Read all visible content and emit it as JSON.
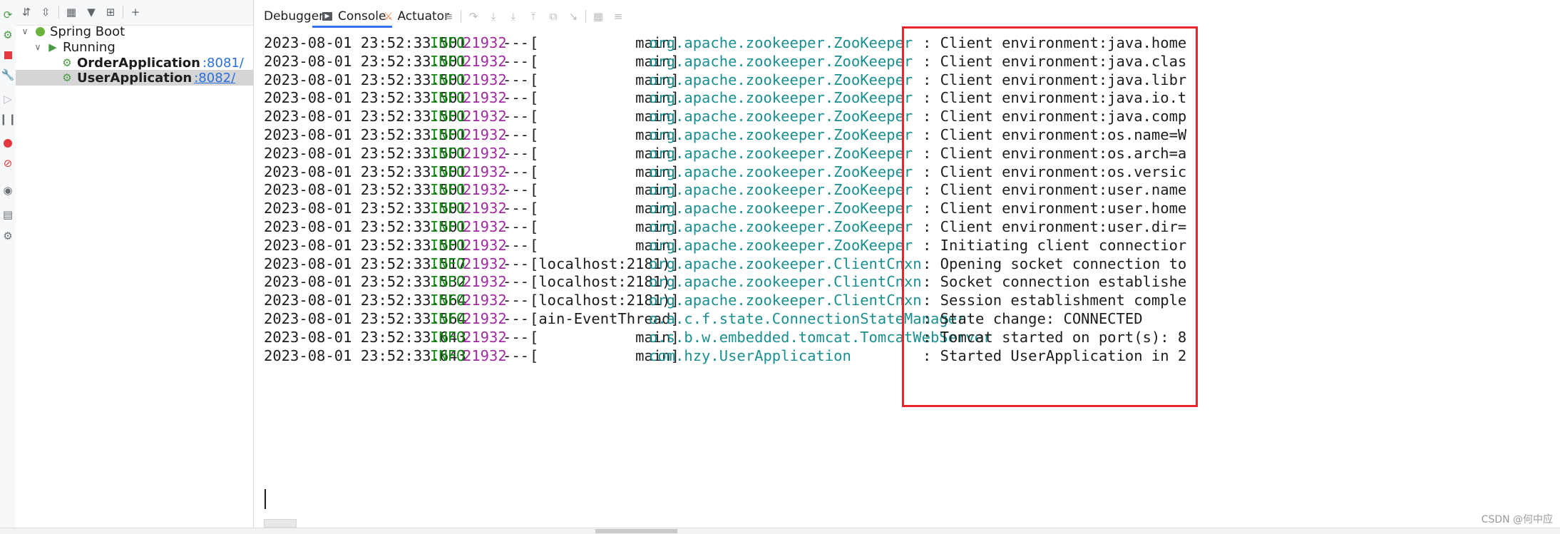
{
  "tree": {
    "root": "Spring Boot",
    "group": "Running",
    "apps": [
      {
        "name": "OrderApplication",
        "port": ":8081/"
      },
      {
        "name": "UserApplication",
        "port": ":8082/"
      }
    ]
  },
  "tabs": {
    "debugger": "Debugger",
    "console": "Console",
    "actuator": "Actuator"
  },
  "log": [
    {
      "ts": "2023-08-01 23:52:33.501",
      "level": "INFO",
      "pid": "21932",
      "sep": "---",
      "thread": "[           main]",
      "logger": "org.apache.zookeeper.ZooKeeper",
      "msg": ": Client environment:java.home"
    },
    {
      "ts": "2023-08-01 23:52:33.501",
      "level": "INFO",
      "pid": "21932",
      "sep": "---",
      "thread": "[           main]",
      "logger": "org.apache.zookeeper.ZooKeeper",
      "msg": ": Client environment:java.clas"
    },
    {
      "ts": "2023-08-01 23:52:33.501",
      "level": "INFO",
      "pid": "21932",
      "sep": "---",
      "thread": "[           main]",
      "logger": "org.apache.zookeeper.ZooKeeper",
      "msg": ": Client environment:java.libr"
    },
    {
      "ts": "2023-08-01 23:52:33.501",
      "level": "INFO",
      "pid": "21932",
      "sep": "---",
      "thread": "[           main]",
      "logger": "org.apache.zookeeper.ZooKeeper",
      "msg": ": Client environment:java.io.t"
    },
    {
      "ts": "2023-08-01 23:52:33.501",
      "level": "INFO",
      "pid": "21932",
      "sep": "---",
      "thread": "[           main]",
      "logger": "org.apache.zookeeper.ZooKeeper",
      "msg": ": Client environment:java.comp"
    },
    {
      "ts": "2023-08-01 23:52:33.501",
      "level": "INFO",
      "pid": "21932",
      "sep": "---",
      "thread": "[           main]",
      "logger": "org.apache.zookeeper.ZooKeeper",
      "msg": ": Client environment:os.name=W"
    },
    {
      "ts": "2023-08-01 23:52:33.501",
      "level": "INFO",
      "pid": "21932",
      "sep": "---",
      "thread": "[           main]",
      "logger": "org.apache.zookeeper.ZooKeeper",
      "msg": ": Client environment:os.arch=a"
    },
    {
      "ts": "2023-08-01 23:52:33.501",
      "level": "INFO",
      "pid": "21932",
      "sep": "---",
      "thread": "[           main]",
      "logger": "org.apache.zookeeper.ZooKeeper",
      "msg": ": Client environment:os.versic"
    },
    {
      "ts": "2023-08-01 23:52:33.501",
      "level": "INFO",
      "pid": "21932",
      "sep": "---",
      "thread": "[           main]",
      "logger": "org.apache.zookeeper.ZooKeeper",
      "msg": ": Client environment:user.name"
    },
    {
      "ts": "2023-08-01 23:52:33.501",
      "level": "INFO",
      "pid": "21932",
      "sep": "---",
      "thread": "[           main]",
      "logger": "org.apache.zookeeper.ZooKeeper",
      "msg": ": Client environment:user.home"
    },
    {
      "ts": "2023-08-01 23:52:33.501",
      "level": "INFO",
      "pid": "21932",
      "sep": "---",
      "thread": "[           main]",
      "logger": "org.apache.zookeeper.ZooKeeper",
      "msg": ": Client environment:user.dir="
    },
    {
      "ts": "2023-08-01 23:52:33.501",
      "level": "INFO",
      "pid": "21932",
      "sep": "---",
      "thread": "[           main]",
      "logger": "org.apache.zookeeper.ZooKeeper",
      "msg": ": Initiating client connectior"
    },
    {
      "ts": "2023-08-01 23:52:33.517",
      "level": "INFO",
      "pid": "21932",
      "sep": "---",
      "thread": "[localhost:2181)]",
      "logger": "org.apache.zookeeper.ClientCnxn",
      "msg": ": Opening socket connection to"
    },
    {
      "ts": "2023-08-01 23:52:33.532",
      "level": "INFO",
      "pid": "21932",
      "sep": "---",
      "thread": "[localhost:2181)]",
      "logger": "org.apache.zookeeper.ClientCnxn",
      "msg": ": Socket connection establishe"
    },
    {
      "ts": "2023-08-01 23:52:33.564",
      "level": "INFO",
      "pid": "21932",
      "sep": "---",
      "thread": "[localhost:2181)]",
      "logger": "org.apache.zookeeper.ClientCnxn",
      "msg": ": Session establishment comple"
    },
    {
      "ts": "2023-08-01 23:52:33.564",
      "level": "INFO",
      "pid": "21932",
      "sep": "---",
      "thread": "[ain-EventThread]",
      "logger": "o.a.c.f.state.ConnectionStateManager",
      "msg": ": State change: CONNECTED"
    },
    {
      "ts": "2023-08-01 23:52:33.643",
      "level": "INFO",
      "pid": "21932",
      "sep": "---",
      "thread": "[           main]",
      "logger": "o.s.b.w.embedded.tomcat.TomcatWebServer",
      "msg": ": Tomcat started on port(s): 8"
    },
    {
      "ts": "2023-08-01 23:52:33.643",
      "level": "INFO",
      "pid": "21932",
      "sep": "---",
      "thread": "[           main]",
      "logger": "com.hzy.UserApplication",
      "msg": ": Started UserApplication in 2"
    }
  ],
  "watermark": "CSDN @何中应",
  "colors": {
    "accent": "#3574f0",
    "highlight_box": "#e8232a",
    "level_info": "#138a13",
    "pid": "#a12ba1",
    "logger": "#1a8f8f"
  },
  "icons": {
    "left_toolbar": [
      "rerun-icon",
      "debug-icon",
      "stop-icon",
      "wrench-icon",
      "resume-icon",
      "pause-icon",
      "breakpoints-icon",
      "mute-breakpoints-icon",
      "camera-icon",
      "layout-icon",
      "settings-icon"
    ],
    "tree_toolbar": [
      "expand-all-icon",
      "collapse-all-icon",
      "group-icon",
      "filter-icon",
      "new-tab-icon",
      "add-icon"
    ],
    "console_toolbar": [
      "menu-icon",
      "step-over-icon",
      "step-into-icon",
      "force-step-into-icon",
      "step-out-icon",
      "drop-frame-icon",
      "run-to-cursor-icon",
      "evaluate-icon",
      "trace-icon"
    ]
  }
}
